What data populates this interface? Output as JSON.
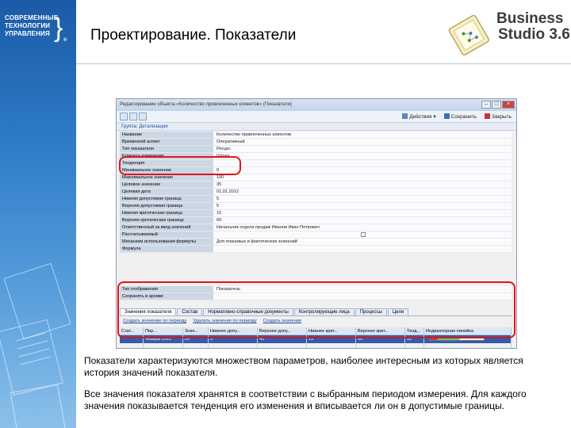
{
  "brand_left": {
    "line1": "СОВРЕМЕННЫЕ",
    "line2": "ТЕХНОЛОГИИ",
    "line3": "УПРАВЛЕНИЯ",
    "reg": "®"
  },
  "header": {
    "title": "Проектирование. Показатели"
  },
  "product_logo": {
    "line1": "Business",
    "line2": "Studio 3.6"
  },
  "app_window": {
    "title": "Редактирование объекта «Количество привлеченных клиентов» (Показатели)",
    "toolbar": {
      "actions_label": "Действия",
      "save_label": "Сохранить",
      "close_label": "Закрыть"
    },
    "group_title": "Группа: Детализация",
    "properties": [
      {
        "name": "Название",
        "value": "Количество привлеченных клиентов"
      },
      {
        "name": "Временной аспект",
        "value": "Оперативный"
      },
      {
        "name": "Тип показателя",
        "value": "Ресурс"
      },
      {
        "name": "Единица измерения",
        "value": "Штука"
      },
      {
        "name": "Тенденция",
        "value": ""
      },
      {
        "name": "Минимальное значение",
        "value": "0"
      },
      {
        "name": "Максимальное значение",
        "value": "100"
      },
      {
        "name": "Целевое значение",
        "value": "35"
      },
      {
        "name": "Целевая дата",
        "value": "01.01.2012"
      },
      {
        "name": "Нижняя допустимая граница",
        "value": "5"
      },
      {
        "name": "Верхняя допустимая граница",
        "value": "5"
      },
      {
        "name": "Нижняя критическая граница",
        "value": "15"
      },
      {
        "name": "Верхняя критическая граница",
        "value": "60"
      },
      {
        "name": "Ответственный за ввод значений",
        "value": "Начальник отдела продаж Иванов Иван Петрович"
      },
      {
        "name": "Рассчитываемый",
        "value": ""
      },
      {
        "name": "Механизм использования формулы",
        "value": "Для плановых и фактических значений"
      },
      {
        "name": "Формула",
        "value": ""
      }
    ],
    "sub_properties": [
      {
        "name": "Тип отображения",
        "value": "Показатель"
      },
      {
        "name": "Сохранять в архиве",
        "value": ""
      }
    ],
    "tabs": [
      "Значения показателя",
      "Состав",
      "Нормативно-справочные документы",
      "Контролирующие лица",
      "Процессы",
      "Цели"
    ],
    "subtoolbar": [
      "Создать значение по периоду",
      "Удалить значения по периоду",
      "Создать значение"
    ],
    "grid": {
      "columns": [
        "Стат...",
        "Пер...",
        "Знач...",
        "Нижнее допу...",
        "Верхнее допу...",
        "Нижнее крит...",
        "Верхнее крит...",
        "Тенд...",
        "Индикаторная линейка"
      ],
      "rows": [
        [
          "",
          "Январь 2011",
          "20",
          "3",
          "40",
          "15",
          "60",
          "11",
          ""
        ],
        [
          "",
          "",
          "",
          "",
          "",
          "",
          "",
          "",
          ""
        ]
      ]
    }
  },
  "paragraphs": {
    "p1": "Показатели характеризуются множеством параметров, наиболее интересным из которых является история значений показателя.",
    "p2": "Все значения показателя хранятся в соответствии с выбранным периодом измерения. Для каждого значения показывается тенденция его изменения и вписывается ли он в допустимые границы."
  },
  "colors": {
    "left_band": "#2f7dc8",
    "highlight": "#e3141b",
    "selected_row": "#2f5fae"
  }
}
